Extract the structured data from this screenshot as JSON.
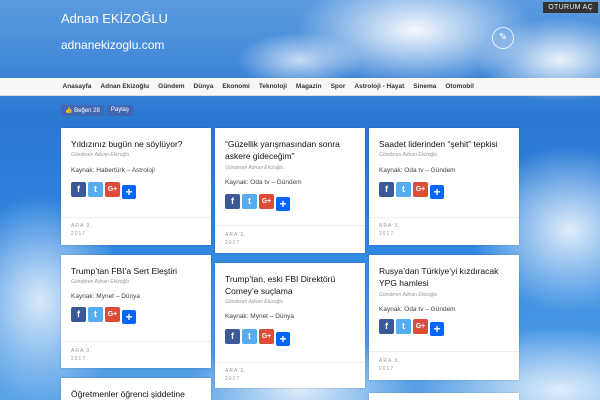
{
  "header": {
    "site_title": "Adnan EKİZOĞLU",
    "site_url": "adnanekizoglu.com",
    "login_label": "OTURUM AÇ"
  },
  "nav": {
    "items": [
      "Anasayfa",
      "Adnan Ekizoğlu",
      "Gündem",
      "Dünya",
      "Ekonomi",
      "Teknoloji",
      "Magazin",
      "Spor",
      "Astroloji - Hayat",
      "Sinema",
      "Otomobil"
    ]
  },
  "social": {
    "like_label": "Beğen 28",
    "share_label": "Paylaş"
  },
  "share_icons": {
    "facebook": "f",
    "twitter": "t",
    "googleplus": "G+",
    "more": "+"
  },
  "cards": [
    {
      "title": "Yıldızınız bugün ne söylüyor?",
      "author": "Gönderen Adnan Ekizoğlu",
      "source": "Kaynak: Habertürk – Astroloji",
      "date_day": "ARA 3,",
      "date_year": "2017"
    },
    {
      "title": "“Güzellik yarışmasından sonra askere gideceğim”",
      "author": "Gönderen Adnan Ekizoğlu",
      "source": "Kaynak: Oda tv – Gündem",
      "date_day": "ARA 3,",
      "date_year": "2017"
    },
    {
      "title": "Saadet liderinden “şehit” tepkisi",
      "author": "Gönderen Adnan Ekizoğlu",
      "source": "Kaynak: Oda tv – Gündem",
      "date_day": "ARA 3,",
      "date_year": "2017"
    },
    {
      "title": "Trump’tan FBI’a Sert Eleştiri",
      "author": "Gönderen Adnan Ekizoğlu",
      "source": "Kaynak: Mynet – Dünya",
      "date_day": "ARA 3,",
      "date_year": "2017"
    },
    {
      "title": "Trump’tan, eski FBI Direktörü Comey’e suçlama",
      "author": "Gönderen Adnan Ekizoğlu",
      "source": "Kaynak: Mynet – Dünya",
      "date_day": "ARA 3,",
      "date_year": "2017"
    },
    {
      "title": "Rusya’dan Türkiye’yi kızdıracak YPG hamlesi",
      "author": "Gönderen Adnan Ekizoğlu",
      "source": "Kaynak: Oda tv – Gündem",
      "date_day": "ARA 3,",
      "date_year": "2017"
    },
    {
      "title": "Öğretmenler öğrenci şiddetine",
      "author": "",
      "source": "",
      "date_day": "",
      "date_year": ""
    }
  ],
  "colors": {
    "facebook": "#3b5998",
    "twitter": "#55acee",
    "googleplus": "#dd4b39",
    "addthis": "#0166ff",
    "nav_bg": "#f7f7f7"
  }
}
